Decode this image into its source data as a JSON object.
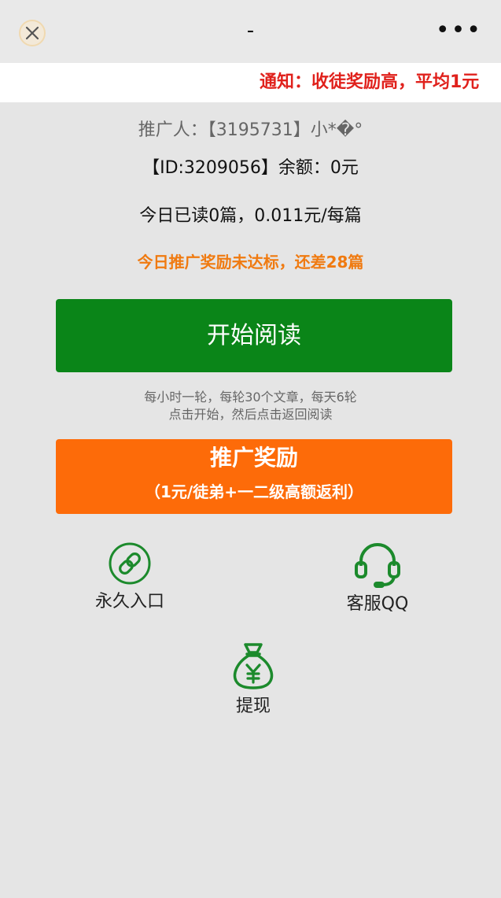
{
  "header": {
    "title": "-",
    "more_label": "•••"
  },
  "notice": {
    "text": "通知：收徒奖励高，平均1元"
  },
  "account": {
    "promoter": "推广人：【3195731】小*�°",
    "id_balance": "【ID:3209056】余额：0元",
    "today_read": "今日已读0篇，0.011元/每篇",
    "warning": "今日推广奖励未达标，还差28篇"
  },
  "read_button": {
    "label": "开始阅读"
  },
  "tips": {
    "line1": "每小时一轮，每轮30个文章，每天6轮",
    "line2": "点击开始，然后点击返回阅读"
  },
  "promo_button": {
    "title": "推广奖励",
    "subtitle": "（1元/徒弟+一二级高额返利）"
  },
  "tools": {
    "entry": {
      "label": "永久入口",
      "icon": "link-icon"
    },
    "qq": {
      "label": "客服QQ",
      "icon": "headset-icon"
    },
    "cash": {
      "label": "提现",
      "icon": "money-bag-icon"
    }
  },
  "colors": {
    "green": "#0a8518",
    "orange": "#fd6b09",
    "notice_red": "#e0211c",
    "warn_orange": "#f07a10"
  }
}
